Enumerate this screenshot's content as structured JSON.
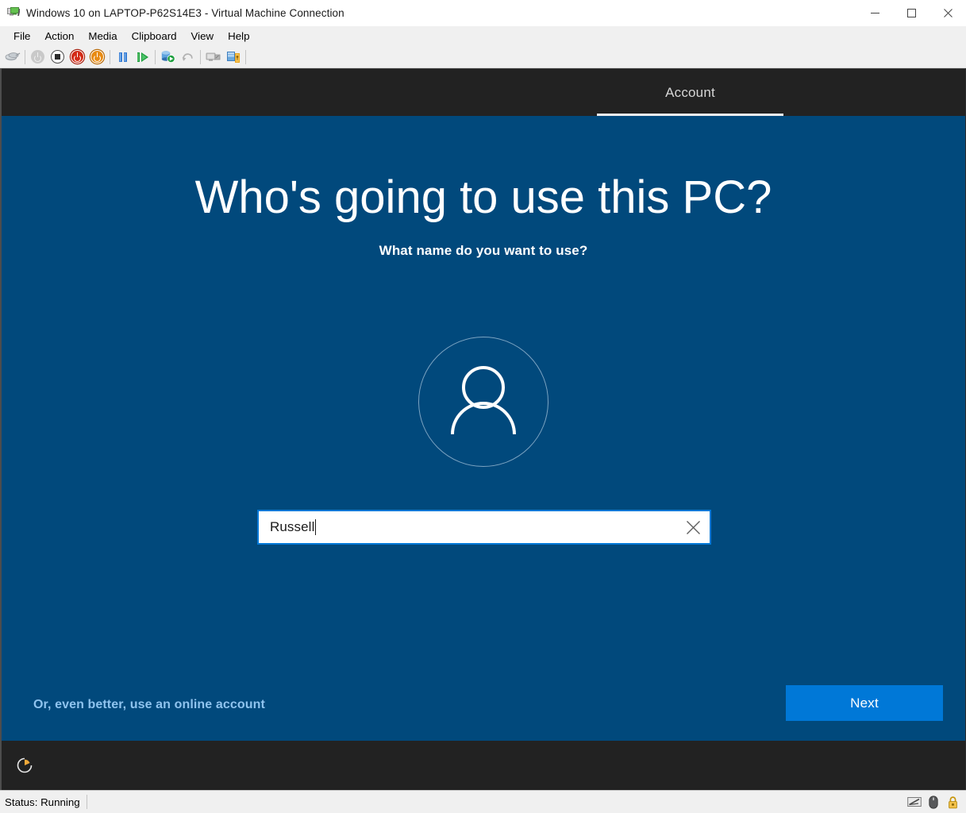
{
  "window": {
    "title": "Windows 10 on LAPTOP-P62S14E3 - Virtual Machine Connection",
    "icon": "virtual-machine-icon",
    "controls": {
      "minimize": "Minimize",
      "maximize": "Maximize",
      "close": "Close"
    }
  },
  "menubar": {
    "items": [
      {
        "label": "File"
      },
      {
        "label": "Action"
      },
      {
        "label": "Media"
      },
      {
        "label": "Clipboard"
      },
      {
        "label": "View"
      },
      {
        "label": "Help"
      }
    ]
  },
  "toolbar": {
    "buttons": [
      {
        "name": "ctrl-alt-delete-icon",
        "title": "Ctrl+Alt+Delete",
        "enabled": true
      },
      {
        "name": "start-icon",
        "title": "Start",
        "enabled": false
      },
      {
        "name": "turn-off-icon",
        "title": "Turn Off",
        "enabled": true
      },
      {
        "name": "shut-down-icon",
        "title": "Shut Down",
        "enabled": true
      },
      {
        "name": "reset-icon",
        "title": "Reset",
        "enabled": true
      },
      {
        "name": "pause-icon",
        "title": "Pause",
        "enabled": true
      },
      {
        "name": "resume-icon",
        "title": "Resume",
        "enabled": true
      },
      {
        "name": "checkpoint-icon",
        "title": "Checkpoint",
        "enabled": true
      },
      {
        "name": "revert-icon",
        "title": "Revert",
        "enabled": false
      },
      {
        "name": "enhanced-session-icon",
        "title": "Enhanced Session",
        "enabled": false
      },
      {
        "name": "share-icon",
        "title": "Share",
        "enabled": true
      }
    ]
  },
  "vm_screen": {
    "tabs": [
      {
        "label": "Account",
        "selected": true
      }
    ],
    "headline": "Who's going to use this PC?",
    "subhead": "What name do you want to use?",
    "avatar_icon": "person-icon",
    "name_input": {
      "value": "Russell",
      "placeholder": "",
      "clear_icon": "close-icon"
    },
    "online_account_link": "Or, even better, use an online account",
    "next_button": "Next",
    "ease_of_access_icon": "ease-of-access-icon",
    "colors": {
      "background": "#01497c",
      "header": "#222222",
      "accent": "#0078d7",
      "link": "#8fc3ee"
    }
  },
  "statusbar": {
    "status": "Status: Running",
    "icons": [
      {
        "name": "keyboard-icon"
      },
      {
        "name": "mouse-icon"
      },
      {
        "name": "lock-icon"
      }
    ]
  }
}
